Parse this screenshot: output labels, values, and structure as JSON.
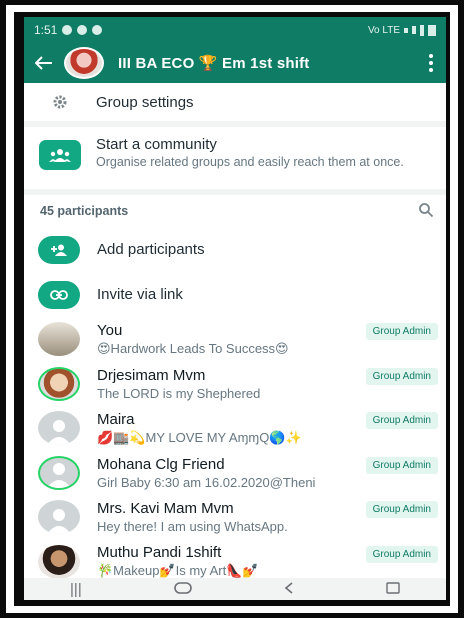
{
  "status_bar": {
    "time": "1:51",
    "right_text": "Vo LTE"
  },
  "app_bar": {
    "title": "III BA ECO 🏆 Em 1st shift"
  },
  "settings": {
    "label": "Group settings"
  },
  "community": {
    "title": "Start a community",
    "subtitle": "Organise related groups and easily reach them at once."
  },
  "participants": {
    "count_label": "45 participants",
    "actions": [
      {
        "label": "Add participants",
        "icon": "add-person-icon"
      },
      {
        "label": "Invite via link",
        "icon": "link-icon"
      }
    ],
    "members": [
      {
        "name": "You",
        "status": "😍Hardwork Leads To Success😍",
        "badge": "Group Admin",
        "avatar": "photo"
      },
      {
        "name": "Drjesimam Mvm",
        "status": "The LORD is my Shephered",
        "badge": "Group Admin",
        "avatar": "photo-ring"
      },
      {
        "name": "Maira",
        "status": "💋🏬💫MY LOVE MY AɱɱQ🌎✨",
        "badge": "Group Admin",
        "avatar": "default"
      },
      {
        "name": "Mohana Clg Friend",
        "status": "Girl Baby 6:30 am 16.02.2020@Theni",
        "badge": "Group Admin",
        "avatar": "default-ring"
      },
      {
        "name": "Mrs. Kavi Mam Mvm",
        "status": "Hey there! I am using WhatsApp.",
        "badge": "Group Admin",
        "avatar": "default"
      },
      {
        "name": "Muthu Pandi 1shift",
        "status": "🎋Makeup💅Is my Art👠💅",
        "badge": "Group Admin",
        "avatar": "photo"
      }
    ]
  },
  "colors": {
    "primary": "#0f7c65",
    "accent": "#13a884",
    "badge_bg": "#e2f5ee"
  }
}
